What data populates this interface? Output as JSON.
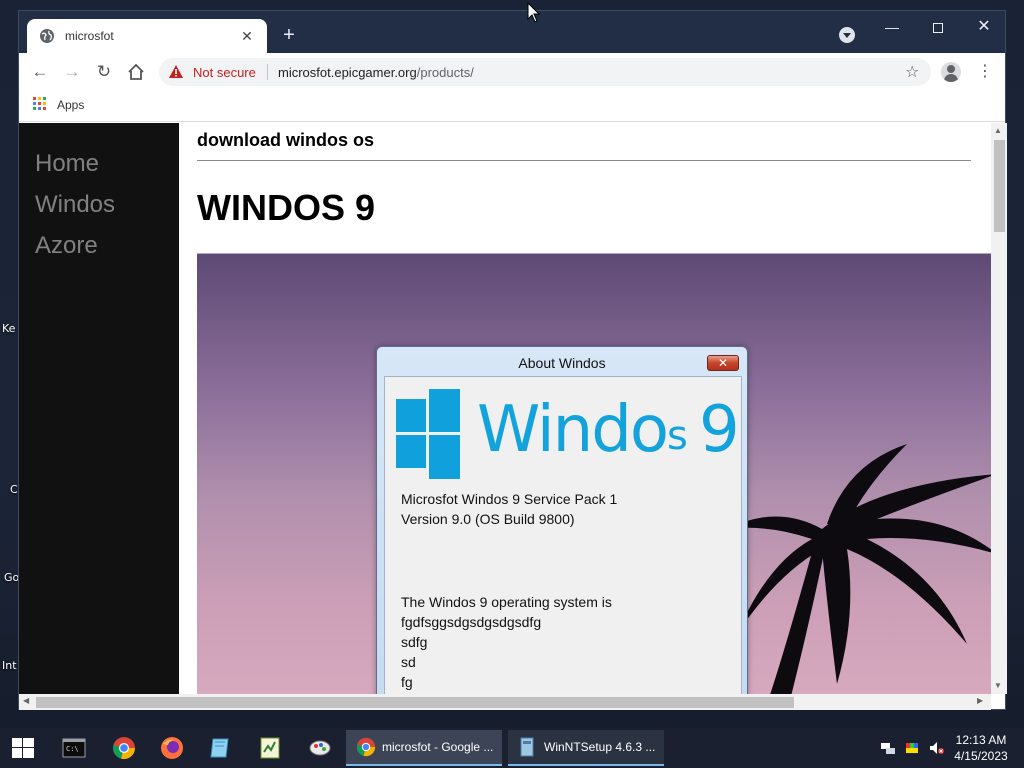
{
  "desktop": {
    "labels": [
      "Ke",
      "C",
      "Go",
      "Int"
    ]
  },
  "browser": {
    "tab_title": "microsfot",
    "new_tab_label": "+",
    "security_label": "Not secure",
    "url_domain": "microsfot.epicgamer.org",
    "url_path": "/products/",
    "bookmarks": {
      "apps_label": "Apps"
    }
  },
  "page": {
    "nav": [
      "Home",
      "Windos",
      "Azore"
    ],
    "subtitle": "download windos os",
    "headline": "WINDOS 9",
    "dialog": {
      "title": "About Windos",
      "logo_text_a": "Windo",
      "logo_text_b": "s",
      "logo_text_c": "9",
      "product_line": "Microsfot Windos 9 Service Pack 1",
      "version_line": "Version 9.0 (OS Build 9800)",
      "body_lines": [
        "The Windos 9 operating system is",
        "fgdfsggsdgsdgsdgsdfg",
        "sdfg",
        "sd",
        "fg"
      ]
    }
  },
  "taskbar": {
    "tasks": [
      {
        "label": "microsfot - Google ..."
      },
      {
        "label": "WinNTSetup 4.6.3   ..."
      }
    ],
    "clock": {
      "time": "12:13 AM",
      "date": "4/15/2023"
    }
  },
  "colors": {
    "accent": "#10a0dc",
    "danger": "#c5221f",
    "sidebar_bg": "#111111",
    "tabbar_bg": "#222e45"
  }
}
